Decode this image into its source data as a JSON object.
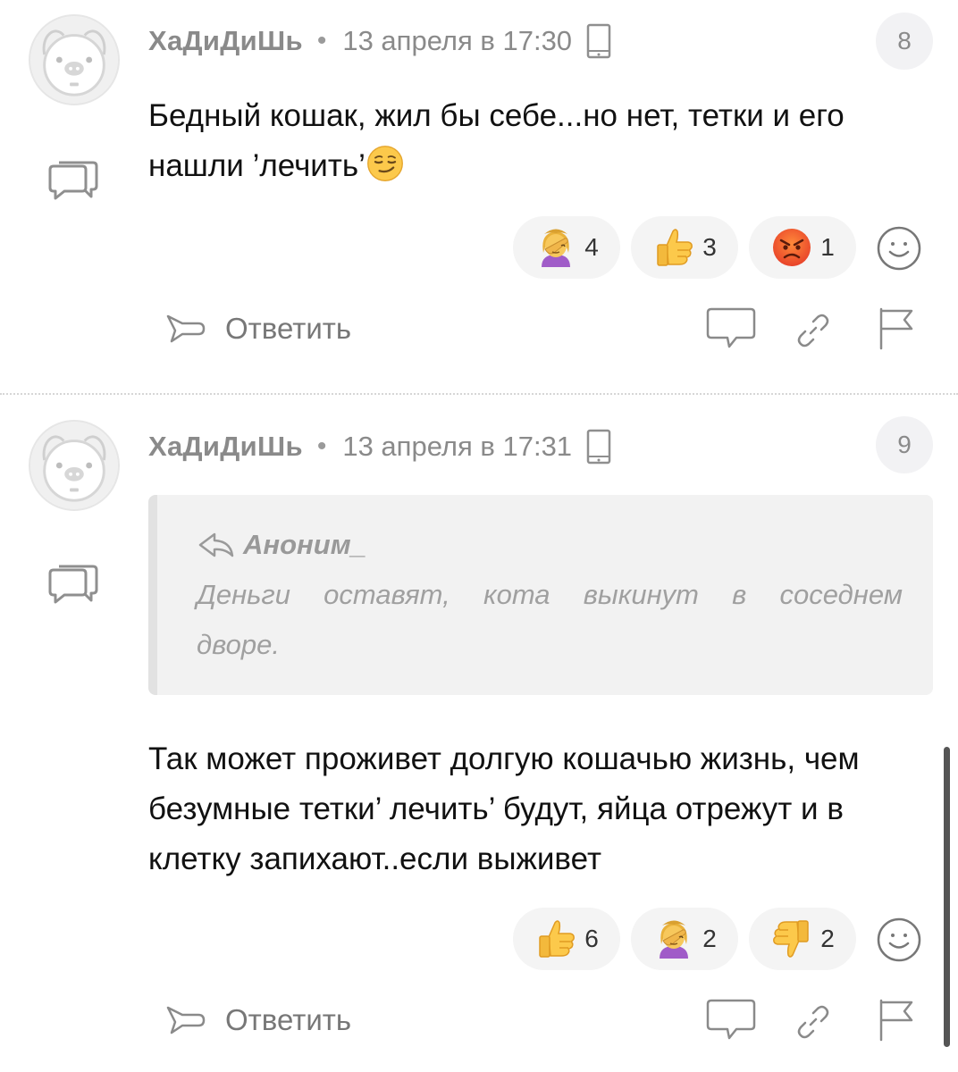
{
  "comments": [
    {
      "author": "ХаДиДиШь",
      "date": "13 апреля в 17:30",
      "number": "8",
      "text": "Бедный кошак, жил бы себе...но нет, тетки и его нашли ’лечить’",
      "text_emoji": "smirk-emoji",
      "reactions": [
        {
          "icon": "facepalm-emoji",
          "count": "4"
        },
        {
          "icon": "thumbs-up-emoji",
          "count": "3"
        },
        {
          "icon": "angry-face-emoji",
          "count": "1"
        }
      ],
      "reply_label": "Ответить"
    },
    {
      "author": "ХаДиДиШь",
      "date": "13 апреля в 17:31",
      "number": "9",
      "quote": {
        "author": "Аноним_",
        "text": "Деньги оставят, кота выкинут в соседнем дворе."
      },
      "text": "Так может проживет долгую кошачью жизнь, чем безумные тетки’ лечить’ будут, яйца отрежут и в клетку запихают..если выживет",
      "reactions": [
        {
          "icon": "thumbs-up-emoji",
          "count": "6"
        },
        {
          "icon": "facepalm-emoji",
          "count": "2"
        },
        {
          "icon": "thumbs-down-emoji",
          "count": "2"
        }
      ],
      "reply_label": "Ответить"
    }
  ],
  "colors": {
    "meta_gray": "#8a8a8a",
    "quote_bg": "#f2f2f2",
    "reaction_bg": "#f4f4f4",
    "text": "#111111"
  }
}
